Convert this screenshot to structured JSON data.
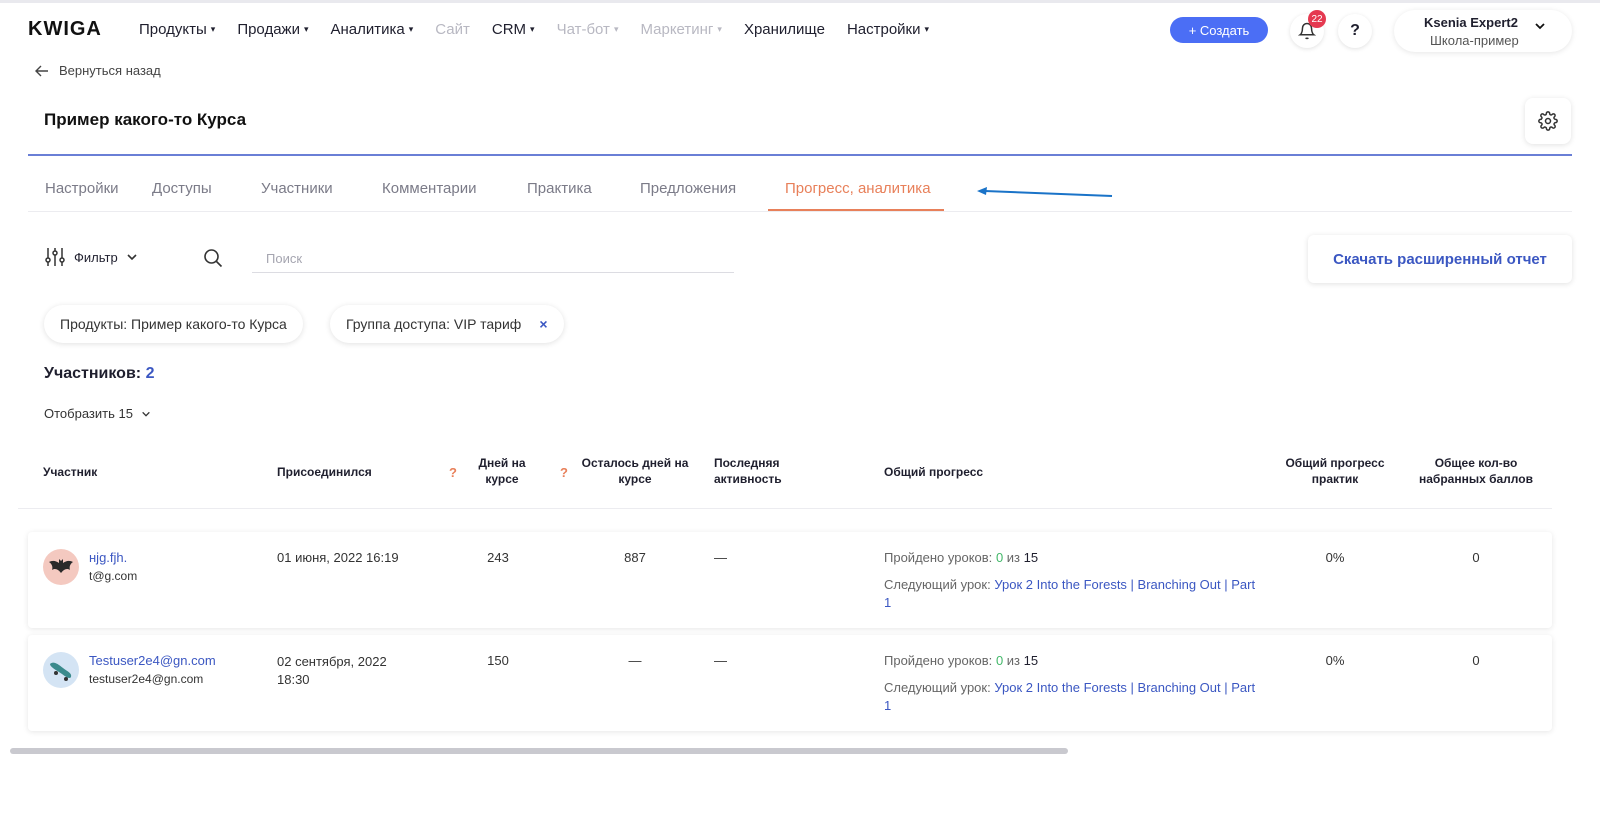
{
  "header": {
    "logo": "KWIGA",
    "nav": [
      {
        "label": "Продукты",
        "caret": true,
        "disabled": false
      },
      {
        "label": "Продажи",
        "caret": true,
        "disabled": false
      },
      {
        "label": "Аналитика",
        "caret": true,
        "disabled": false
      },
      {
        "label": "Сайт",
        "caret": false,
        "disabled": true
      },
      {
        "label": "CRM",
        "caret": true,
        "disabled": false
      },
      {
        "label": "Чат-бот",
        "caret": true,
        "disabled": true
      },
      {
        "label": "Маркетинг",
        "caret": true,
        "disabled": true
      },
      {
        "label": "Хранилище",
        "caret": false,
        "disabled": false
      },
      {
        "label": "Настройки",
        "caret": true,
        "disabled": false
      }
    ],
    "create_label": "+ Создать",
    "notifications_count": "22",
    "help_label": "?",
    "account_name": "Ksenia Expert2",
    "account_school": "Школа-пример"
  },
  "back_label": "Вернуться назад",
  "course_title": "Пример какого-то Курса",
  "tabs": [
    {
      "label": "Настройки",
      "active": false
    },
    {
      "label": "Доступы",
      "active": false
    },
    {
      "label": "Участники",
      "active": false
    },
    {
      "label": "Комментарии",
      "active": false
    },
    {
      "label": "Практика",
      "active": false
    },
    {
      "label": "Предложения",
      "active": false
    },
    {
      "label": "Прогресс, аналитика",
      "active": true
    }
  ],
  "filter": {
    "label": "Фильтр",
    "search_placeholder": "Поиск",
    "report_button": "Скачать расширенный отчет",
    "chips": [
      {
        "label": "Продукты: Пример какого-то Курса",
        "removable": false
      },
      {
        "label": "Группа доступа: VIP тариф",
        "removable": true,
        "remove_icon": "×"
      }
    ]
  },
  "participants": {
    "label": "Участников:",
    "count": "2",
    "show_label": "Отобразить 15"
  },
  "table": {
    "headers": {
      "participant": "Участник",
      "joined": "Присоединился",
      "days_on_course": "Дней на курсе",
      "days_left": "Осталось дней на курсе",
      "last_activity": "Последняя активность",
      "total_progress": "Общий прогресс",
      "practice_progress": "Общий прогресс практик",
      "total_points": "Общее кол-во набранных баллов",
      "help_mark": "?"
    },
    "rows": [
      {
        "name": "нjg.fjh.",
        "email": "t@g.com",
        "avatar_icon": "bat-icon",
        "avatar_bg": "#f4c9c0",
        "joined": "01 июня, 2022 16:19",
        "days_on_course": "243",
        "days_left": "887",
        "last_activity": "—",
        "lessons_label": "Пройдено уроков:",
        "lessons_done": "0",
        "lessons_of": "из",
        "lessons_total": "15",
        "next_label": "Следующий урок:",
        "next_lesson": "Урок 2 Into the Forests | Branching Out | Part 1",
        "practice_progress": "0%",
        "points": "0"
      },
      {
        "name": "Testuser2e4@gn.com",
        "email": "testuser2e4@gn.com",
        "avatar_icon": "skateboard-icon",
        "avatar_bg": "#d4e4f4",
        "joined": "02 сентября, 2022 18:30",
        "days_on_course": "150",
        "days_left": "—",
        "last_activity": "—",
        "lessons_label": "Пройдено уроков:",
        "lessons_done": "0",
        "lessons_of": "из",
        "lessons_total": "15",
        "next_label": "Следующий урок:",
        "next_lesson": "Урок 2 Into the Forests | Branching Out | Part 1",
        "practice_progress": "0%",
        "points": "0"
      }
    ]
  },
  "colors": {
    "accent_blue": "#4b6ef5",
    "link_blue": "#3b57c2",
    "active_tab": "#e8805a",
    "success_green": "#43b86a",
    "badge_red": "#e53950",
    "annotation_arrow": "#1a73c8"
  }
}
